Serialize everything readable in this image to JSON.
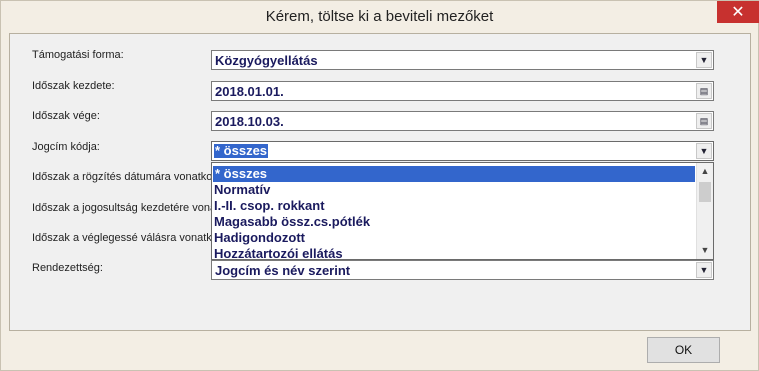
{
  "window": {
    "title": "Kérem, töltse ki a beviteli mezőket",
    "close": "✕"
  },
  "labels": {
    "tamogatasi_forma": "Támogatási forma:",
    "idoszak_kezdete": "Időszak kezdete:",
    "idoszak_vege": "Időszak vége:",
    "jogcim_kodja": "Jogcím kódja:",
    "rogzites": "Időszak a rögzítés dátumára vonatkoz",
    "jogosultsag": "Időszak a jogosultság kezdetére vona",
    "veglegesse": "Időszak a véglegessé válásra vonatko",
    "rendezettseg": "Rendezettség:"
  },
  "fields": {
    "tamogatasi_forma": "Közgyógyellátás",
    "idoszak_kezdete": "2018.01.01.",
    "idoszak_vege": "2018.10.03.",
    "jogcim_kodja": "* összes",
    "rendezettseg": "Jogcím és név szerint"
  },
  "dropdown": {
    "items": [
      "* összes",
      "Normatív",
      "I.-II. csop. rokkant",
      "Magasabb össz.cs.pótlék",
      "Hadigondozott",
      "Hozzátartozói ellátás"
    ]
  },
  "buttons": {
    "ok": "OK"
  },
  "icons": {
    "dropdown": "chevron-down-icon",
    "calendar": "calendar-icon",
    "close": "close-icon"
  }
}
